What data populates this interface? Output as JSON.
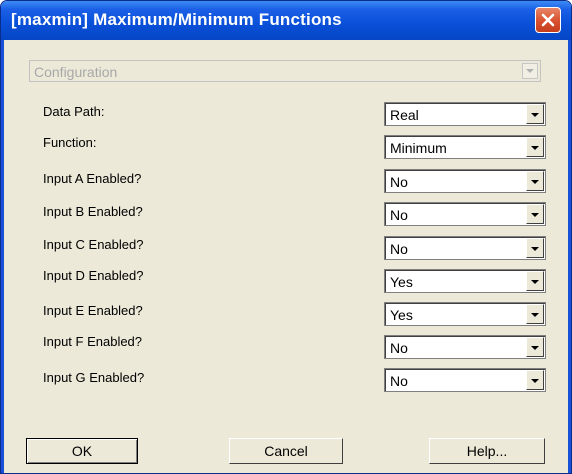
{
  "window": {
    "title": "[maxmin] Maximum/Minimum Functions"
  },
  "config": {
    "label": "Configuration"
  },
  "rows": [
    {
      "label": "Data Path:",
      "value": "Real"
    },
    {
      "label": "Function:",
      "value": "Minimum"
    },
    {
      "label": "Input A Enabled?",
      "value": "No"
    },
    {
      "label": "Input B Enabled?",
      "value": "No"
    },
    {
      "label": "Input C Enabled?",
      "value": "No"
    },
    {
      "label": "Input D Enabled?",
      "value": "Yes"
    },
    {
      "label": "Input E Enabled?",
      "value": "Yes"
    },
    {
      "label": "Input F Enabled?",
      "value": "No"
    },
    {
      "label": "Input G Enabled?",
      "value": "No"
    }
  ],
  "buttons": {
    "ok": "OK",
    "cancel": "Cancel",
    "help": "Help..."
  },
  "icons": {
    "close": "close-icon",
    "dropdown": "chevron-down-icon"
  },
  "colors": {
    "titlebar": "#0a4fd8",
    "close": "#d8502e",
    "face": "#ece9d8"
  }
}
